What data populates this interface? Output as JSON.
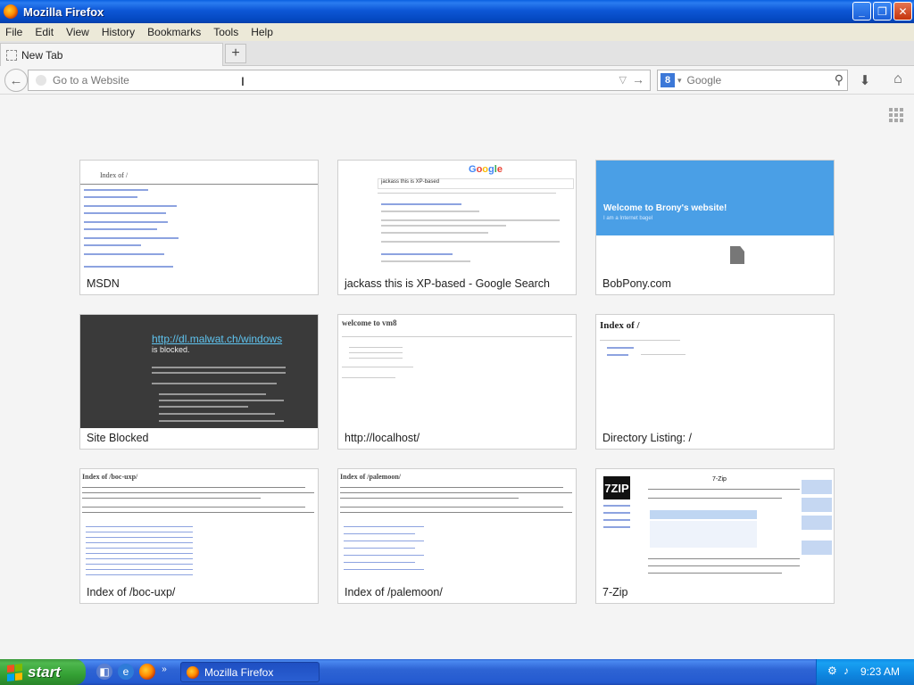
{
  "window": {
    "title": "Mozilla Firefox",
    "buttons": {
      "minimize": "_",
      "maximize": "❐",
      "close": "✕"
    }
  },
  "menu": [
    "File",
    "Edit",
    "View",
    "History",
    "Bookmarks",
    "Tools",
    "Help"
  ],
  "tabs": [
    {
      "label": "New Tab"
    }
  ],
  "new_tab_button": "+",
  "nav": {
    "back_glyph": "←",
    "url_placeholder": "Go to a Website",
    "search_engine": "Google",
    "search_placeholder": "Google"
  },
  "tiles": [
    {
      "title": "MSDN",
      "preview": "Index of /"
    },
    {
      "title": "jackass this is XP-based - Google Search",
      "preview": "jackass this is XP-based",
      "logo": "Google"
    },
    {
      "title": "BobPony.com",
      "preview": "Welcome to Brony's website!",
      "sub": "I am a Internet bagel"
    },
    {
      "title": "Site Blocked",
      "preview_link": "http://dl.malwat.ch/windows",
      "preview_rest": "is blocked."
    },
    {
      "title": "http://localhost/",
      "preview": "welcome to vm8"
    },
    {
      "title": "Directory Listing: /",
      "preview": "Index of /"
    },
    {
      "title": "Index of /boc-uxp/",
      "preview": "Index of /boc-uxp/"
    },
    {
      "title": "Index of /palemoon/",
      "preview": "Index of /palemoon/"
    },
    {
      "title": "7-Zip",
      "preview": "7-Zip",
      "logo": "7ZIP"
    }
  ],
  "taskbar": {
    "start_label": "start",
    "task_label": "Mozilla Firefox",
    "clock": "9:23 AM"
  },
  "colors": {
    "titlebar": "#0d57d6",
    "start": "#34a034",
    "brony_header": "#4a9fe6",
    "blocked_bg": "#3a3a3a"
  }
}
